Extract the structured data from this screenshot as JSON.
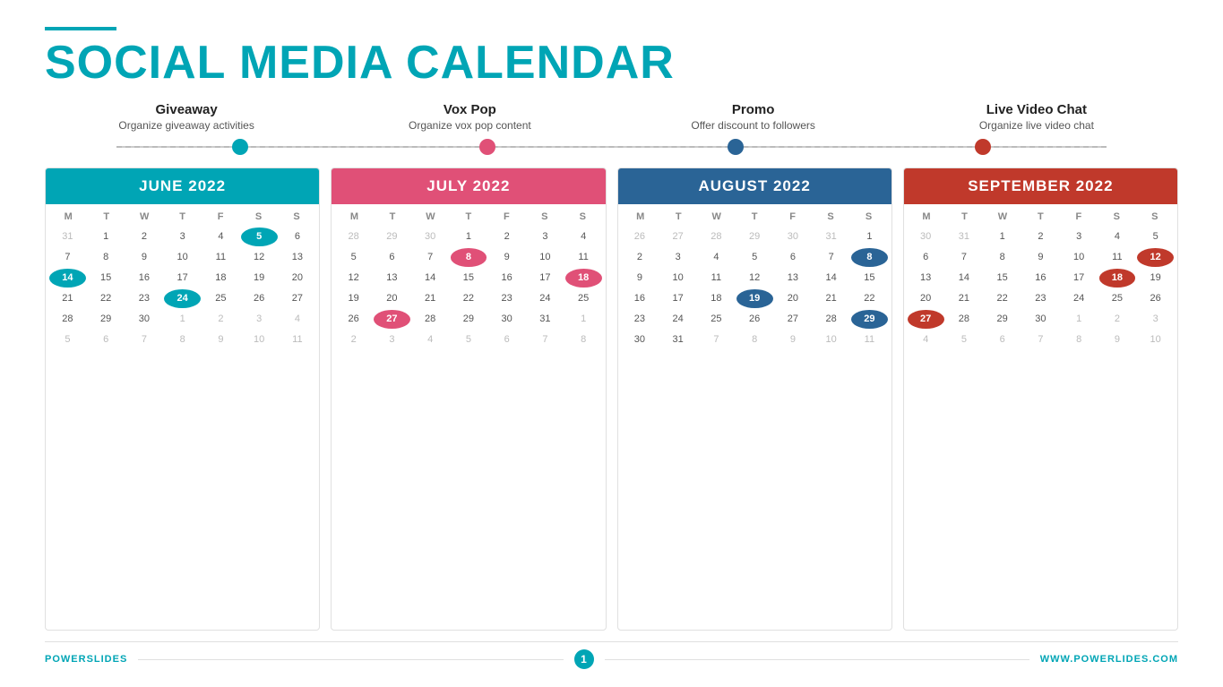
{
  "header": {
    "line_color": "#00a5b5",
    "title_part1": "SOCIAL MEDIA ",
    "title_part2": "CALENDAR"
  },
  "categories": [
    {
      "title": "Giveaway",
      "subtitle": "Organize giveaway activities",
      "dot_class": "dot-blue"
    },
    {
      "title": "Vox Pop",
      "subtitle": "Organize vox pop content",
      "dot_class": "dot-red"
    },
    {
      "title": "Promo",
      "subtitle": "Offer discount to followers",
      "dot_class": "dot-dark"
    },
    {
      "title": "Live Video Chat",
      "subtitle": "Organize live video chat",
      "dot_class": "dot-darkred"
    }
  ],
  "calendars": [
    {
      "month": "JUNE 2022",
      "header_class": "cal-header-blue",
      "weekdays": [
        "M",
        "T",
        "W",
        "T",
        "F",
        "S",
        "S"
      ],
      "days": [
        {
          "n": "31",
          "cls": "other-month"
        },
        {
          "n": "1",
          "cls": ""
        },
        {
          "n": "2",
          "cls": ""
        },
        {
          "n": "3",
          "cls": ""
        },
        {
          "n": "4",
          "cls": ""
        },
        {
          "n": "5",
          "cls": "highlight-blue"
        },
        {
          "n": "6",
          "cls": ""
        },
        {
          "n": "7",
          "cls": ""
        },
        {
          "n": "8",
          "cls": ""
        },
        {
          "n": "9",
          "cls": ""
        },
        {
          "n": "10",
          "cls": ""
        },
        {
          "n": "11",
          "cls": ""
        },
        {
          "n": "12",
          "cls": ""
        },
        {
          "n": "13",
          "cls": ""
        },
        {
          "n": "14",
          "cls": "highlight-blue"
        },
        {
          "n": "15",
          "cls": ""
        },
        {
          "n": "16",
          "cls": ""
        },
        {
          "n": "17",
          "cls": ""
        },
        {
          "n": "18",
          "cls": ""
        },
        {
          "n": "19",
          "cls": ""
        },
        {
          "n": "20",
          "cls": ""
        },
        {
          "n": "21",
          "cls": ""
        },
        {
          "n": "22",
          "cls": ""
        },
        {
          "n": "23",
          "cls": ""
        },
        {
          "n": "24",
          "cls": "highlight-blue"
        },
        {
          "n": "25",
          "cls": ""
        },
        {
          "n": "26",
          "cls": ""
        },
        {
          "n": "27",
          "cls": ""
        },
        {
          "n": "28",
          "cls": ""
        },
        {
          "n": "29",
          "cls": ""
        },
        {
          "n": "30",
          "cls": ""
        },
        {
          "n": "1",
          "cls": "other-month"
        },
        {
          "n": "2",
          "cls": "other-month"
        },
        {
          "n": "3",
          "cls": "other-month"
        },
        {
          "n": "4",
          "cls": "other-month"
        },
        {
          "n": "5",
          "cls": "other-month"
        },
        {
          "n": "6",
          "cls": "other-month"
        },
        {
          "n": "7",
          "cls": "other-month"
        },
        {
          "n": "8",
          "cls": "other-month"
        },
        {
          "n": "9",
          "cls": "other-month"
        },
        {
          "n": "10",
          "cls": "other-month"
        },
        {
          "n": "11",
          "cls": "other-month"
        }
      ]
    },
    {
      "month": "JULY 2022",
      "header_class": "cal-header-red",
      "weekdays": [
        "M",
        "T",
        "W",
        "T",
        "F",
        "S",
        "S"
      ],
      "days": [
        {
          "n": "28",
          "cls": "other-month"
        },
        {
          "n": "29",
          "cls": "other-month"
        },
        {
          "n": "30",
          "cls": "other-month"
        },
        {
          "n": "1",
          "cls": ""
        },
        {
          "n": "2",
          "cls": ""
        },
        {
          "n": "3",
          "cls": ""
        },
        {
          "n": "4",
          "cls": ""
        },
        {
          "n": "5",
          "cls": ""
        },
        {
          "n": "6",
          "cls": ""
        },
        {
          "n": "7",
          "cls": ""
        },
        {
          "n": "8",
          "cls": "highlight-red"
        },
        {
          "n": "9",
          "cls": ""
        },
        {
          "n": "10",
          "cls": ""
        },
        {
          "n": "11",
          "cls": ""
        },
        {
          "n": "12",
          "cls": ""
        },
        {
          "n": "13",
          "cls": ""
        },
        {
          "n": "14",
          "cls": ""
        },
        {
          "n": "15",
          "cls": ""
        },
        {
          "n": "16",
          "cls": ""
        },
        {
          "n": "17",
          "cls": ""
        },
        {
          "n": "18",
          "cls": "highlight-red"
        },
        {
          "n": "19",
          "cls": ""
        },
        {
          "n": "20",
          "cls": ""
        },
        {
          "n": "21",
          "cls": ""
        },
        {
          "n": "22",
          "cls": ""
        },
        {
          "n": "23",
          "cls": ""
        },
        {
          "n": "24",
          "cls": ""
        },
        {
          "n": "25",
          "cls": ""
        },
        {
          "n": "26",
          "cls": ""
        },
        {
          "n": "27",
          "cls": "highlight-red"
        },
        {
          "n": "28",
          "cls": ""
        },
        {
          "n": "29",
          "cls": ""
        },
        {
          "n": "30",
          "cls": ""
        },
        {
          "n": "31",
          "cls": ""
        },
        {
          "n": "1",
          "cls": "other-month"
        },
        {
          "n": "2",
          "cls": "other-month"
        },
        {
          "n": "3",
          "cls": "other-month"
        },
        {
          "n": "4",
          "cls": "other-month"
        },
        {
          "n": "5",
          "cls": "other-month"
        },
        {
          "n": "6",
          "cls": "other-month"
        },
        {
          "n": "7",
          "cls": "other-month"
        },
        {
          "n": "8",
          "cls": "other-month"
        }
      ]
    },
    {
      "month": "AUGUST 2022",
      "header_class": "cal-header-darkblue",
      "weekdays": [
        "M",
        "T",
        "W",
        "T",
        "F",
        "S",
        "S"
      ],
      "days": [
        {
          "n": "26",
          "cls": "other-month"
        },
        {
          "n": "27",
          "cls": "other-month"
        },
        {
          "n": "28",
          "cls": "other-month"
        },
        {
          "n": "29",
          "cls": "other-month"
        },
        {
          "n": "30",
          "cls": "other-month"
        },
        {
          "n": "31",
          "cls": "other-month"
        },
        {
          "n": "1",
          "cls": ""
        },
        {
          "n": "2",
          "cls": ""
        },
        {
          "n": "3",
          "cls": ""
        },
        {
          "n": "4",
          "cls": ""
        },
        {
          "n": "5",
          "cls": ""
        },
        {
          "n": "6",
          "cls": ""
        },
        {
          "n": "7",
          "cls": ""
        },
        {
          "n": "8",
          "cls": "highlight-darkblue"
        },
        {
          "n": "9",
          "cls": ""
        },
        {
          "n": "10",
          "cls": ""
        },
        {
          "n": "11",
          "cls": ""
        },
        {
          "n": "12",
          "cls": ""
        },
        {
          "n": "13",
          "cls": ""
        },
        {
          "n": "14",
          "cls": ""
        },
        {
          "n": "15",
          "cls": ""
        },
        {
          "n": "16",
          "cls": ""
        },
        {
          "n": "17",
          "cls": ""
        },
        {
          "n": "18",
          "cls": ""
        },
        {
          "n": "19",
          "cls": "highlight-darkblue"
        },
        {
          "n": "20",
          "cls": ""
        },
        {
          "n": "21",
          "cls": ""
        },
        {
          "n": "22",
          "cls": ""
        },
        {
          "n": "23",
          "cls": ""
        },
        {
          "n": "24",
          "cls": ""
        },
        {
          "n": "25",
          "cls": ""
        },
        {
          "n": "26",
          "cls": ""
        },
        {
          "n": "27",
          "cls": ""
        },
        {
          "n": "28",
          "cls": ""
        },
        {
          "n": "29",
          "cls": "highlight-darkblue"
        },
        {
          "n": "30",
          "cls": ""
        },
        {
          "n": "31",
          "cls": ""
        },
        {
          "n": "7",
          "cls": "other-month"
        },
        {
          "n": "8",
          "cls": "other-month"
        },
        {
          "n": "9",
          "cls": "other-month"
        },
        {
          "n": "10",
          "cls": "other-month"
        },
        {
          "n": "11",
          "cls": "other-month"
        }
      ]
    },
    {
      "month": "SEPTEMBER 2022",
      "header_class": "cal-header-darkred",
      "weekdays": [
        "M",
        "T",
        "W",
        "T",
        "F",
        "S",
        "S"
      ],
      "days": [
        {
          "n": "30",
          "cls": "other-month"
        },
        {
          "n": "31",
          "cls": "other-month"
        },
        {
          "n": "1",
          "cls": ""
        },
        {
          "n": "2",
          "cls": ""
        },
        {
          "n": "3",
          "cls": ""
        },
        {
          "n": "4",
          "cls": ""
        },
        {
          "n": "5",
          "cls": ""
        },
        {
          "n": "6",
          "cls": ""
        },
        {
          "n": "7",
          "cls": ""
        },
        {
          "n": "8",
          "cls": ""
        },
        {
          "n": "9",
          "cls": ""
        },
        {
          "n": "10",
          "cls": ""
        },
        {
          "n": "11",
          "cls": ""
        },
        {
          "n": "12",
          "cls": "highlight-darkred"
        },
        {
          "n": "13",
          "cls": ""
        },
        {
          "n": "14",
          "cls": ""
        },
        {
          "n": "15",
          "cls": ""
        },
        {
          "n": "16",
          "cls": ""
        },
        {
          "n": "17",
          "cls": ""
        },
        {
          "n": "18",
          "cls": "highlight-darkred"
        },
        {
          "n": "19",
          "cls": ""
        },
        {
          "n": "20",
          "cls": ""
        },
        {
          "n": "21",
          "cls": ""
        },
        {
          "n": "22",
          "cls": ""
        },
        {
          "n": "23",
          "cls": ""
        },
        {
          "n": "24",
          "cls": ""
        },
        {
          "n": "25",
          "cls": ""
        },
        {
          "n": "26",
          "cls": ""
        },
        {
          "n": "27",
          "cls": "highlight-darkred"
        },
        {
          "n": "28",
          "cls": ""
        },
        {
          "n": "29",
          "cls": ""
        },
        {
          "n": "30",
          "cls": ""
        },
        {
          "n": "1",
          "cls": "other-month"
        },
        {
          "n": "2",
          "cls": "other-month"
        },
        {
          "n": "3",
          "cls": "other-month"
        },
        {
          "n": "4",
          "cls": "other-month"
        },
        {
          "n": "5",
          "cls": "other-month"
        },
        {
          "n": "6",
          "cls": "other-month"
        },
        {
          "n": "7",
          "cls": "other-month"
        },
        {
          "n": "8",
          "cls": "other-month"
        },
        {
          "n": "9",
          "cls": "other-month"
        },
        {
          "n": "10",
          "cls": "other-month"
        }
      ]
    }
  ],
  "footer": {
    "left_part1": "POWER",
    "left_part2": "SLIDES",
    "page_number": "1",
    "right": "WWW.POWERLIDES.COM"
  }
}
